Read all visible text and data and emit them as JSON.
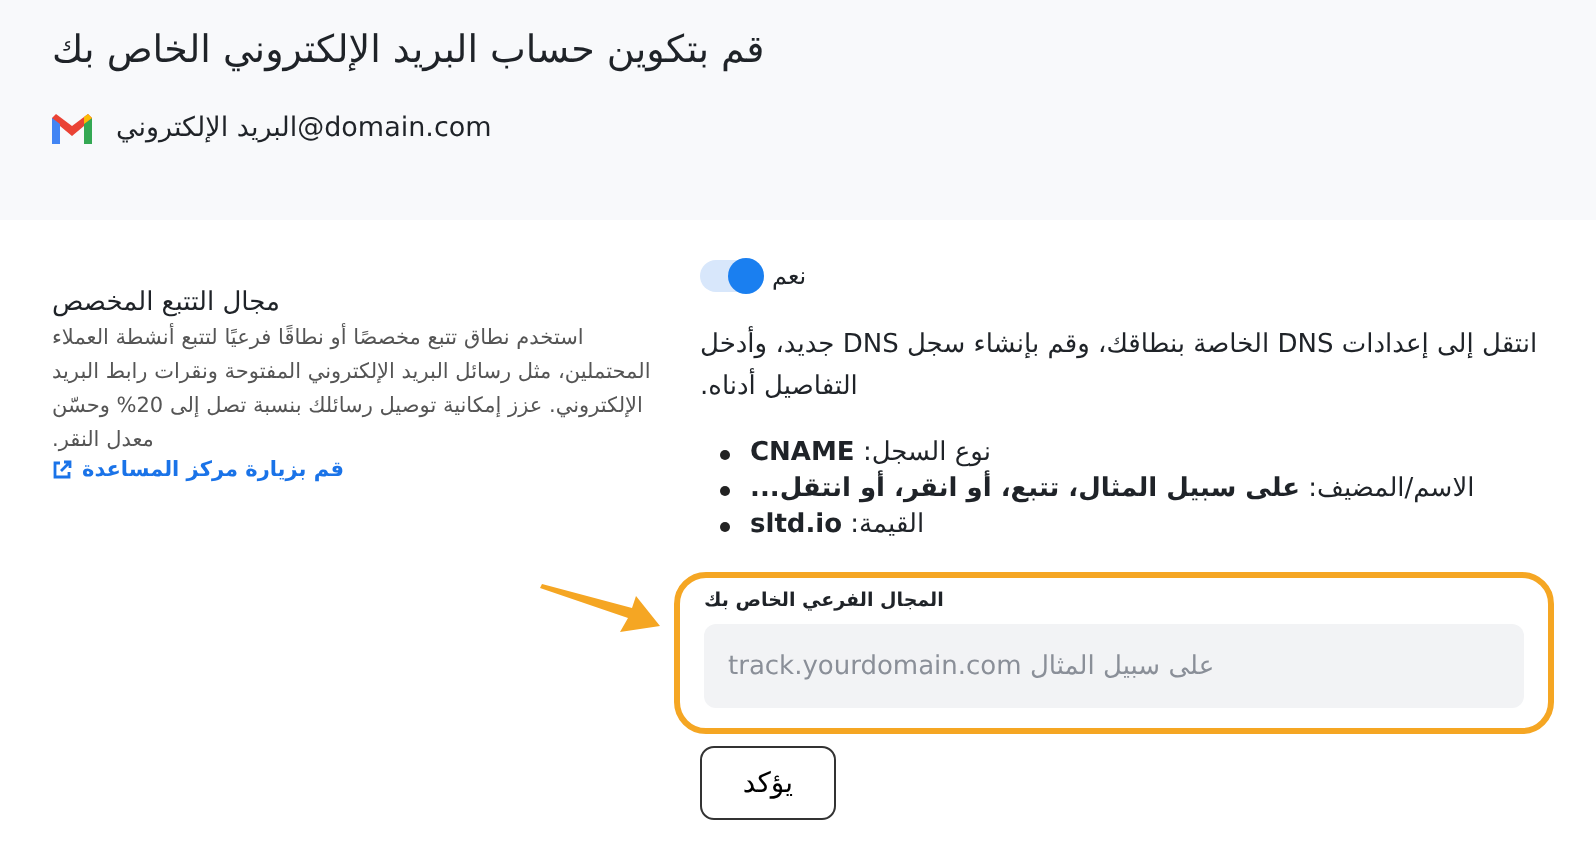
{
  "header": {
    "title": "قم بتكوين حساب البريد الإلكتروني الخاص بك",
    "account": "البريد الإلكتروني@domain.com"
  },
  "tracking": {
    "title": "مجال التتبع المخصص",
    "description": "استخدم نطاق تتبع مخصصًا أو نطاقًا فرعيًا لتتبع أنشطة العملاء المحتملين، مثل رسائل البريد الإلكتروني المفتوحة ونقرات رابط البريد الإلكتروني. عزز إمكانية توصيل رسائلك بنسبة تصل إلى 20% وحسّن معدل النقر.",
    "link": "قم بزيارة مركز المساعدة"
  },
  "toggle": {
    "label": "نعم",
    "on": true
  },
  "instructions": "انتقل إلى إعدادات DNS الخاصة بنطاقك، وقم بإنشاء سجل DNS جديد، وأدخل التفاصيل أدناه.",
  "records": [
    "نوع السجل: **CNAME**",
    "الاسم/المضيف: **على سبيل المثال، تتبع، أو انقر، أو انتقل...**",
    "القيمة: **sltd.io**"
  ],
  "subdomain": {
    "label": "المجال الفرعي الخاص بك",
    "placeholder": "على سبيل المثال track.yourdomain.com",
    "highlighted": true
  },
  "confirm_button": "يؤكد"
}
